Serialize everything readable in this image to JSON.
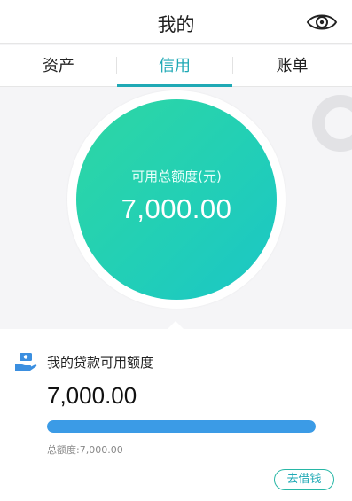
{
  "header": {
    "title": "我的",
    "eye_icon": "eye-icon"
  },
  "tabs": [
    {
      "label": "资产",
      "active": false
    },
    {
      "label": "信用",
      "active": true
    },
    {
      "label": "账单",
      "active": false
    }
  ],
  "hero": {
    "label": "可用总额度(元)",
    "amount": "7,000.00"
  },
  "card": {
    "icon": "hand-money-icon",
    "title": "我的贷款可用额度",
    "amount": "7,000.00",
    "progress": 1.0,
    "total_label": "总额度:7,000.00",
    "borrow_button": "去借钱"
  },
  "colors": {
    "accent": "#1fa9b5",
    "circle_start": "#2ed7a3",
    "circle_end": "#1bc6c6",
    "bar": "#3b9be6"
  }
}
